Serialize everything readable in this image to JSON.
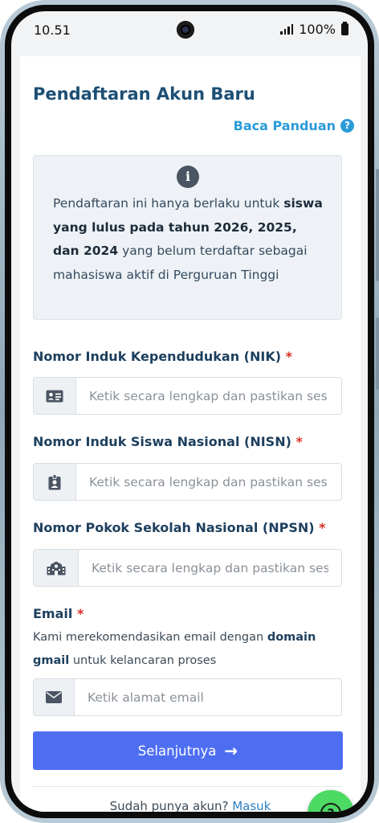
{
  "status_bar": {
    "time": "10.51",
    "battery": "100%"
  },
  "page": {
    "title": "Pendaftaran Akun Baru",
    "guide_link": "Baca Panduan",
    "guide_icon": "?"
  },
  "info": {
    "text_1": "Pendaftaran ini hanya berlaku untuk ",
    "text_bold": "siswa yang lulus pada tahun 2026, 2025, dan 2024",
    "text_2": " yang belum terdaftar sebagai mahasiswa aktif di Perguruan Tinggi"
  },
  "fields": {
    "nik": {
      "label": "Nomor Induk Kependudukan (NIK)",
      "required": "*",
      "placeholder": "Ketik secara lengkap dan pastikan sesuai",
      "icon": "id-card-icon"
    },
    "nisn": {
      "label": "Nomor Induk Siswa Nasional (NISN)",
      "required": "*",
      "placeholder": "Ketik secara lengkap dan pastikan sesuai",
      "icon": "badge-icon"
    },
    "npsn": {
      "label": "Nomor Pokok Sekolah Nasional (NPSN)",
      "required": "*",
      "placeholder": "Ketik secara lengkap dan pastikan sesuai",
      "icon": "school-icon"
    },
    "email": {
      "label": "Email",
      "required": "*",
      "hint_1": "Kami merekomendasikan email dengan ",
      "hint_bold": "domain gmail",
      "hint_2": " untuk kelancaran proses",
      "placeholder": "Ketik alamat email",
      "icon": "envelope-icon"
    }
  },
  "actions": {
    "submit_label": "Selanjutnya",
    "submit_arrow": "→",
    "login_prompt": "Sudah punya akun? ",
    "login_link": "Masuk",
    "help_icon": "?"
  },
  "colors": {
    "title": "#1d4f74",
    "link": "#2b9bd8",
    "primary_button": "#4e6ef2",
    "help_fab": "#4cd964",
    "required": "#d93025"
  }
}
